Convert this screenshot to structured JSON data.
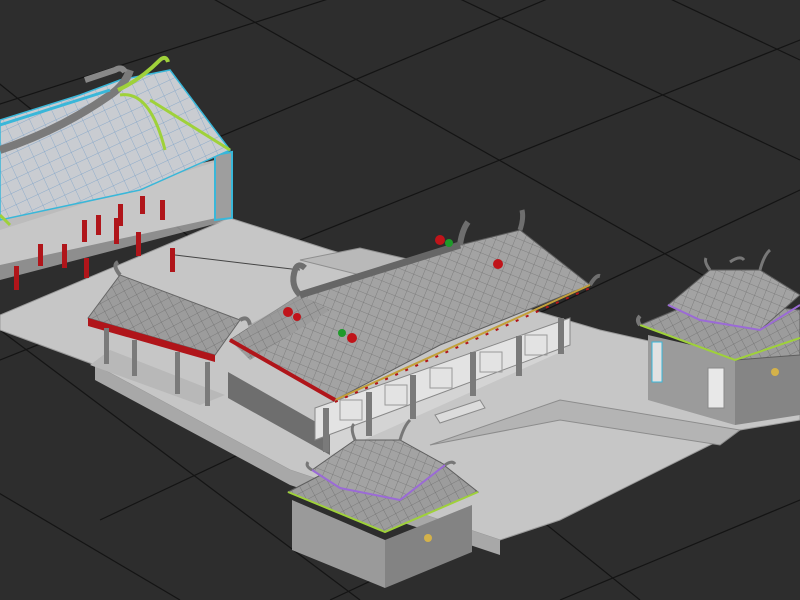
{
  "viewport": {
    "colors": {
      "background": "#2d2d2d",
      "grid": "#141414",
      "ground": "#c8c8c8",
      "roof": "#9a9a9a",
      "roof_tile_lines": "#6e6e6e",
      "wall": "#7a7a7a",
      "wall_light": "#d6d6d6",
      "pillar": "#b0151a",
      "selection_green": "#9fd13a",
      "selection_cyan": "#39b7d9",
      "selection_purple": "#9b6bd6",
      "ornament_red": "#c0141a",
      "ornament_green": "#1f9a2a",
      "gold": "#d4b24a"
    }
  }
}
